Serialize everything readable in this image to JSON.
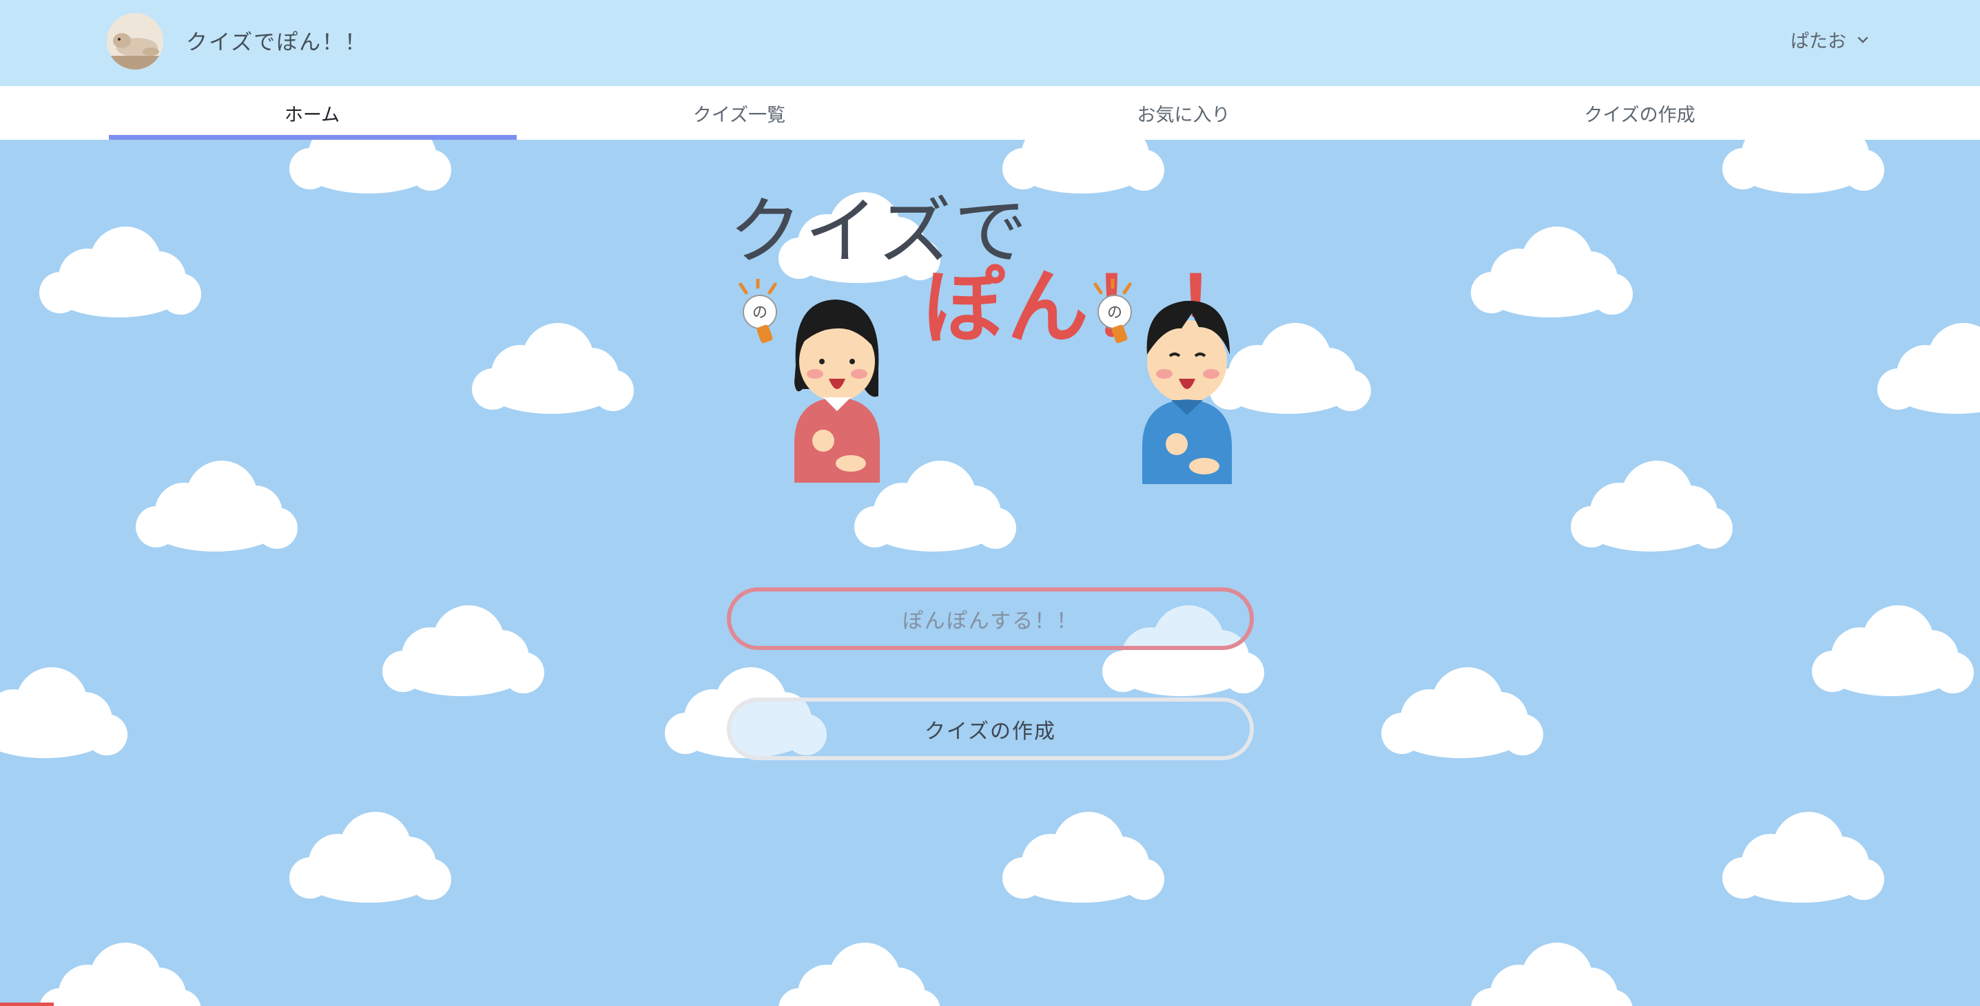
{
  "header": {
    "app_title": "クイズでぽん！！",
    "user_name": "ぱたお",
    "avatar_icon": "avatar-dog-photo",
    "user_menu_icon": "chevron-down-icon"
  },
  "tabs": [
    {
      "label": "ホーム",
      "active": true
    },
    {
      "label": "クイズ一覧",
      "active": false
    },
    {
      "label": "お気に入り",
      "active": false
    },
    {
      "label": "クイズの作成",
      "active": false
    }
  ],
  "hero": {
    "logo_line1": "クイズで",
    "logo_line2": "ぽん！！"
  },
  "actions": {
    "start_label": "ぽんぽんする！！",
    "create_label": "クイズの作成"
  },
  "colors": {
    "header_bg": "#c3e5f9",
    "sky_bg": "#a4d0f3",
    "tab_indicator": "#7d8ff0",
    "logo_red": "#e2524f",
    "start_border": "#e08995"
  }
}
